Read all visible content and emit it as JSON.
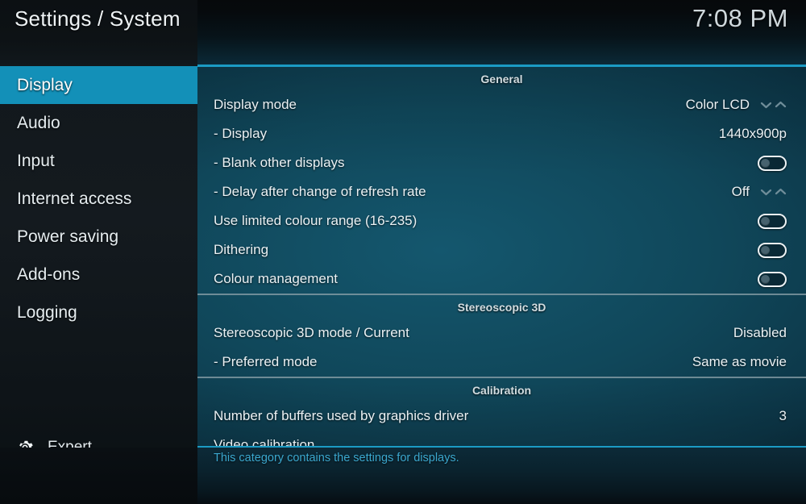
{
  "header": {
    "title": "Settings / System",
    "clock": "7:08 PM"
  },
  "sidebar": {
    "items": [
      {
        "label": "Display",
        "selected": true
      },
      {
        "label": "Audio",
        "selected": false
      },
      {
        "label": "Input",
        "selected": false
      },
      {
        "label": "Internet access",
        "selected": false
      },
      {
        "label": "Power saving",
        "selected": false
      },
      {
        "label": "Add-ons",
        "selected": false
      },
      {
        "label": "Logging",
        "selected": false
      }
    ],
    "expert": {
      "label": "Expert",
      "icon": "gear-icon"
    }
  },
  "panel": {
    "sections": [
      {
        "title": "General",
        "rows": [
          {
            "label": "Display mode",
            "value": "Color LCD",
            "control": "spinner"
          },
          {
            "label": "- Display",
            "value": "1440x900p",
            "control": "value"
          },
          {
            "label": "- Blank other displays",
            "value": "",
            "control": "toggle",
            "toggle_on": false
          },
          {
            "label": "- Delay after change of refresh rate",
            "value": "Off",
            "control": "spinner"
          },
          {
            "label": "Use limited colour range (16-235)",
            "value": "",
            "control": "toggle",
            "toggle_on": false
          },
          {
            "label": "Dithering",
            "value": "",
            "control": "toggle",
            "toggle_on": false
          },
          {
            "label": "Colour management",
            "value": "",
            "control": "toggle",
            "toggle_on": false
          }
        ]
      },
      {
        "title": "Stereoscopic 3D",
        "rows": [
          {
            "label": "Stereoscopic 3D mode / Current",
            "value": "Disabled",
            "control": "value"
          },
          {
            "label": "- Preferred mode",
            "value": "Same as movie",
            "control": "value"
          }
        ]
      },
      {
        "title": "Calibration",
        "rows": [
          {
            "label": "Number of buffers used by graphics driver",
            "value": "3",
            "control": "value"
          },
          {
            "label": "Video calibration",
            "value": "",
            "control": "value"
          }
        ]
      }
    ]
  },
  "description": {
    "text": "This category contains the settings for displays."
  },
  "colors": {
    "accent": "#1b9bc4",
    "selection": "#1390b8",
    "panel_base": "#10475a",
    "description_text": "#3ba8cf",
    "text_primary": "#eaf1f4",
    "section_heading": "#d2dde1"
  }
}
